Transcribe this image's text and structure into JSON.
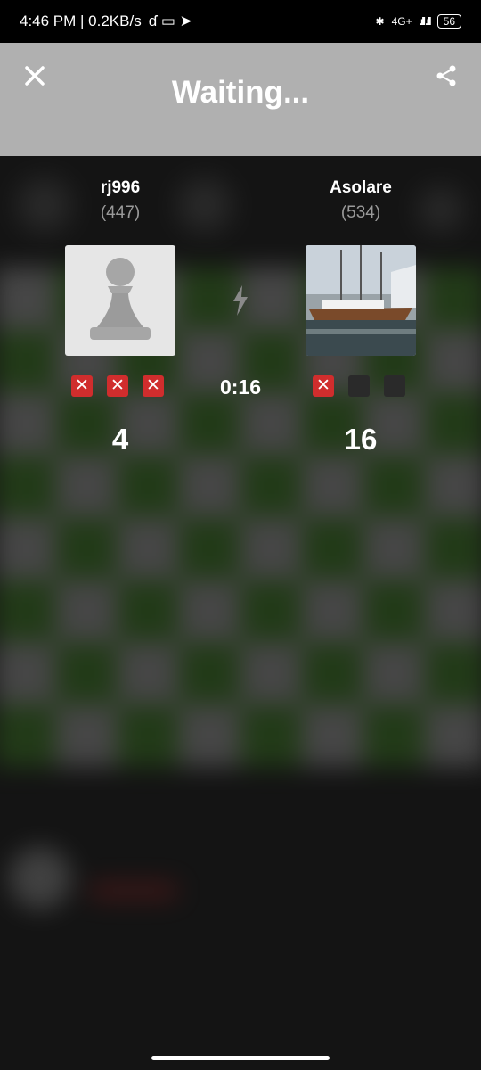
{
  "status_bar": {
    "time_speed": "4:46 PM | 0.2KB/s",
    "network": "4G+",
    "battery": "56"
  },
  "header": {
    "title": "Waiting..."
  },
  "players": {
    "left": {
      "name": "rj996",
      "rating": "(447)",
      "score": "4",
      "marks": [
        "x",
        "x",
        "x"
      ]
    },
    "right": {
      "name": "Asolare",
      "rating": "(534)",
      "score": "16",
      "marks": [
        "x",
        "empty",
        "empty"
      ]
    }
  },
  "timer": "0:16",
  "icons": {
    "close": "close-icon",
    "share": "share-icon",
    "mode": "lightning-bolt-icon",
    "left_avatar": "pawn-avatar-icon",
    "right_avatar": "sailboat-photo-avatar"
  },
  "colors": {
    "header_bg": "#b0b0b0",
    "fail_mark": "#d02d2d",
    "board_dark": "#2e5a1c",
    "board_light": "#6f6f6f"
  }
}
